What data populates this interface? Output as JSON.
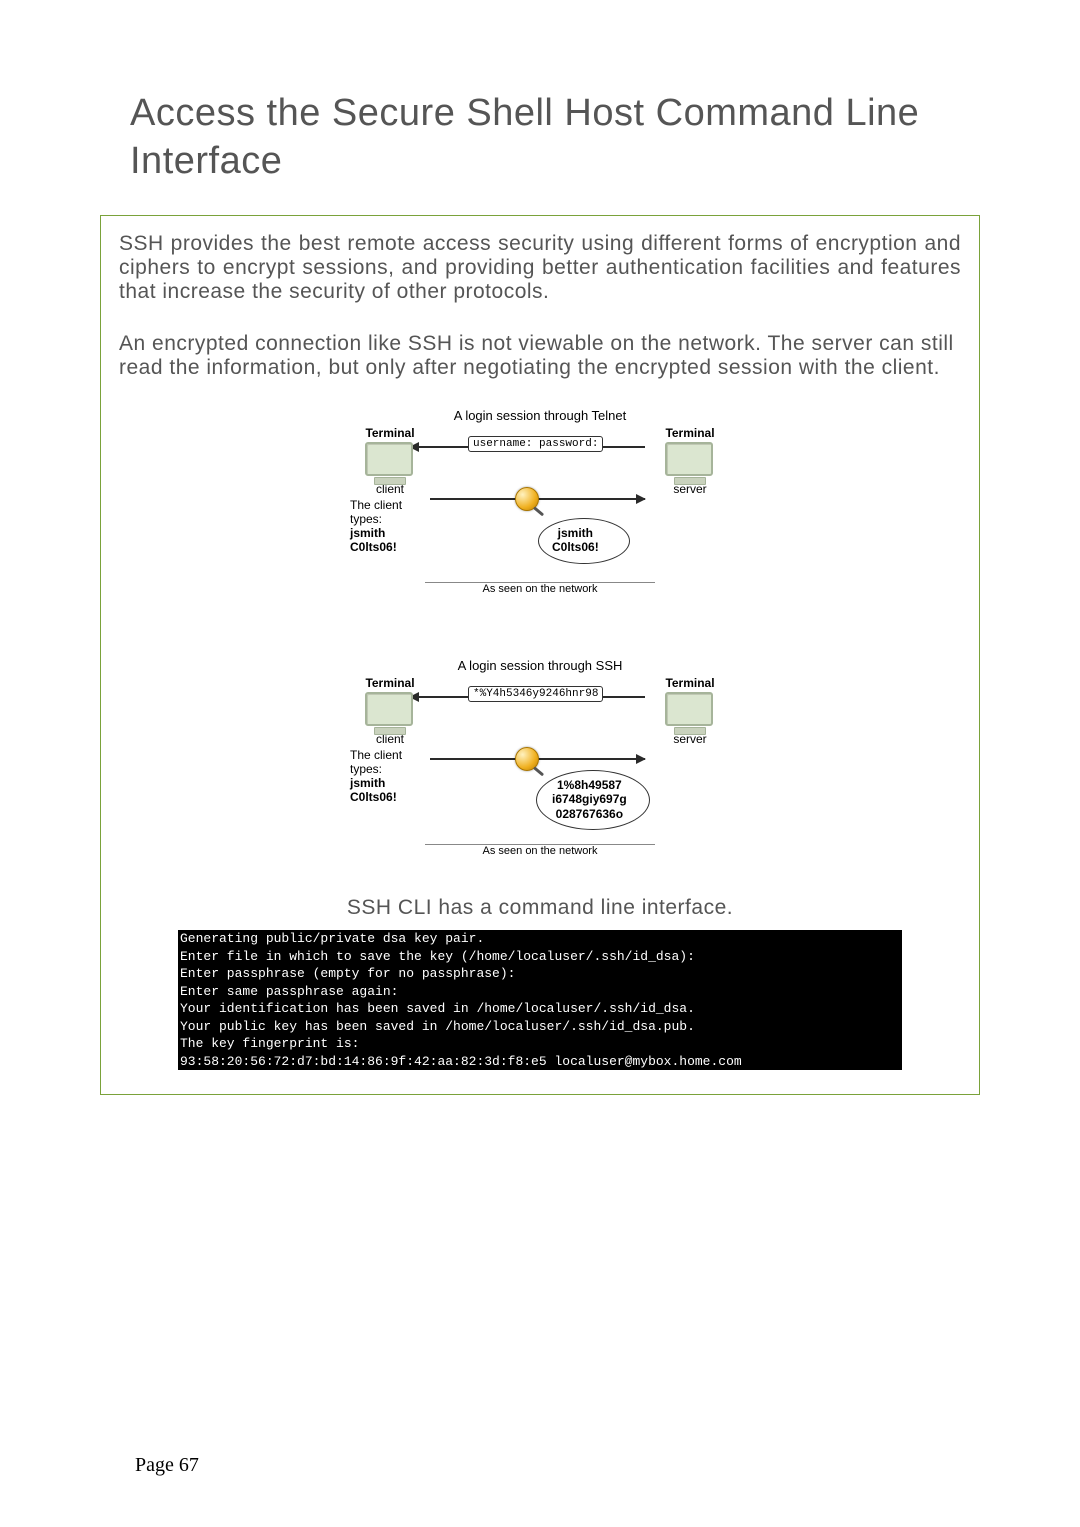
{
  "title": "Access the Secure Shell Host Command Line Interface",
  "para1": "SSH provides the best remote access security using different forms of encryption and ciphers to encrypt sessions, and providing better authentication facilities and features that increase the security of other protocols.",
  "para2": "An encrypted connection like SSH is not viewable on the network. The server can still read the information, but only after negotiating the encrypted session with the client.",
  "diagram1": {
    "title": "A login session through Telnet",
    "left_label": "Terminal",
    "right_label": "Terminal",
    "client": "client",
    "server": "server",
    "types_label": "The client types:",
    "user": "jsmith",
    "pass": "C0lts06!",
    "packet": "username: password:",
    "exposed_user": "jsmith",
    "exposed_pass": "C0lts06!",
    "seen": "As seen on the network"
  },
  "diagram2": {
    "title": "A login session through SSH",
    "left_label": "Terminal",
    "right_label": "Terminal",
    "client": "client",
    "server": "server",
    "types_label": "The client types:",
    "user": "jsmith",
    "pass": "C0lts06!",
    "packet": "*%Y4h5346y9246hnr98",
    "crypt1": "1%8h49587",
    "crypt2": "i6748giy697g",
    "crypt3": "028767636o",
    "seen": "As seen on the network"
  },
  "cli_caption": "SSH CLI has a command line interface.",
  "terminal_lines": [
    "Generating public/private dsa key pair.",
    "Enter file in which to save the key (/home/localuser/.ssh/id_dsa):",
    "Enter passphrase (empty for no passphrase):",
    "Enter same passphrase again:",
    "Your identification has been saved in /home/localuser/.ssh/id_dsa.",
    "Your public key has been saved in /home/localuser/.ssh/id_dsa.pub.",
    "The key fingerprint is:",
    "93:58:20:56:72:d7:bd:14:86:9f:42:aa:82:3d:f8:e5 localuser@mybox.home.com"
  ],
  "page_number": "Page 67"
}
